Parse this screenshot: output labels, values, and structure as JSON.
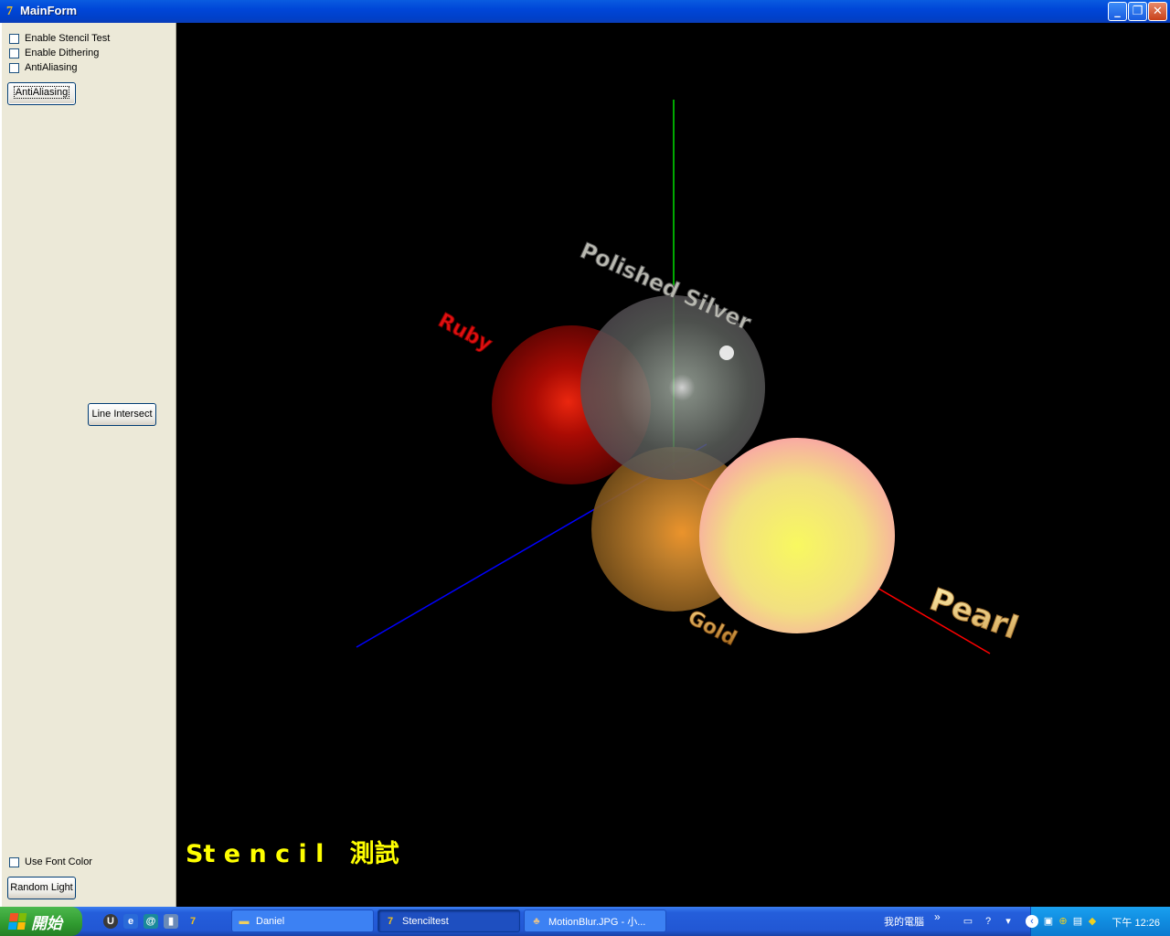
{
  "window": {
    "title": "MainForm",
    "app_icon_glyph": "7"
  },
  "controls": {
    "stencil_test_label": "Enable Stencil Test",
    "dithering_label": "Enable Dithering",
    "antialiasing_check_label": "AntiAliasing",
    "antialiasing_button": "AntiAliasing",
    "line_intersect_button": "Line Intersect",
    "use_font_color_label": "Use Font  Color",
    "random_light_button": "Random Light"
  },
  "scene": {
    "overlay_text": "St e n c i l   測試",
    "labels": {
      "red": "Ruby",
      "silver": "Polished Silver",
      "gold": "Gold",
      "pearl": "Pearl"
    },
    "colors": {
      "x_axis": "#ff0000",
      "y_axis": "#00ff00",
      "z_axis": "#0000ff",
      "overlay": "#ffff00"
    }
  },
  "taskbar": {
    "start_label": "開始",
    "tasks": [
      {
        "label": "Daniel",
        "icon": "folder-icon"
      },
      {
        "label": "Stenciltest",
        "icon": "delphi-icon"
      },
      {
        "label": "MotionBlur.JPG - 小...",
        "icon": "image-viewer-icon"
      }
    ],
    "my_computer_label": "我的電腦",
    "clock": "下午 12:26"
  }
}
